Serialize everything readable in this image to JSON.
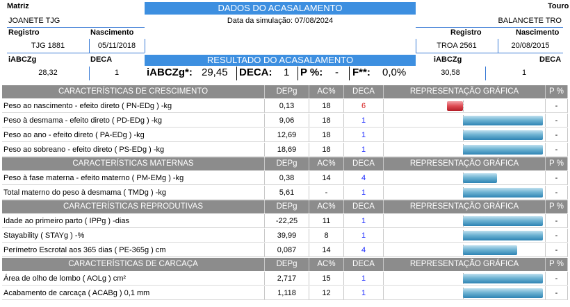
{
  "header": {
    "matriz_label": "Matriz",
    "touro_label": "Touro",
    "title": "DADOS DO ACASALAMENTO",
    "matriz_name": "JOANETE TJG",
    "touro_name": "BALANCETE TRO",
    "sim_date": "Data da simulação: 07/08/2024",
    "matriz": {
      "registro_label": "Registro",
      "nascimento_label": "Nascimento",
      "registro": "TJG 1881",
      "nascimento": "05/11/2018",
      "iabczg_label": "iABCZg",
      "deca_label": "DECA",
      "iabczg": "28,32",
      "deca": "1"
    },
    "touro": {
      "registro_label": "Registro",
      "nascimento_label": "Nascimento",
      "registro": "TROA 2561",
      "nascimento": "20/08/2015",
      "iabczg_label": "iABCZg",
      "deca_label": "DECA",
      "iabczg": "30,58",
      "deca": "1"
    },
    "resultado_title": "RESULTADO DO ACASALAMENTO",
    "resultado": {
      "iabczg_label": "iABCZg*:",
      "iabczg": "29,45",
      "deca_label": "DECA:",
      "deca": "1",
      "p_label": "P %:",
      "p": "-",
      "f_label": "F**:",
      "f": "0,0%"
    }
  },
  "columns": {
    "dep": "DEPg",
    "ac": "AC%",
    "deca": "DECA",
    "graf": "REPRESENTAÇÃO GRÁFICA",
    "p": "P %"
  },
  "colors": {
    "band_blue": "#3d8fe0",
    "section_gray": "#8c8c8c",
    "deca_blue": "#1d2cff",
    "deca_red": "#d62020"
  },
  "sections": [
    {
      "title": "CARACTERÍSTICAS DE CRESCIMENTO",
      "rows": [
        {
          "name": "Peso ao nascimento - efeito direto ( PN-EDg ) -kg",
          "dep": "0,13",
          "ac": "18",
          "deca": "6",
          "deca_color": "red",
          "bar_dir": "neg",
          "bar": 0.2,
          "p": "-"
        },
        {
          "name": "Peso à desmama - efeito direto ( PD-EDg ) -kg",
          "dep": "9,06",
          "ac": "18",
          "deca": "1",
          "deca_color": "blue",
          "bar_dir": "pos",
          "bar": 1.0,
          "p": "-"
        },
        {
          "name": "Peso ao ano - efeito direto ( PA-EDg ) -kg",
          "dep": "12,69",
          "ac": "18",
          "deca": "1",
          "deca_color": "blue",
          "bar_dir": "pos",
          "bar": 1.0,
          "p": "-"
        },
        {
          "name": "Peso ao sobreano - efeito direto ( PS-EDg ) -kg",
          "dep": "18,69",
          "ac": "18",
          "deca": "1",
          "deca_color": "blue",
          "bar_dir": "pos",
          "bar": 1.0,
          "p": "-"
        }
      ]
    },
    {
      "title": "CARACTERÍSTICAS MATERNAS",
      "rows": [
        {
          "name": "Peso à fase materna - efeito materno ( PM-EMg ) -kg",
          "dep": "0,38",
          "ac": "14",
          "deca": "4",
          "deca_color": "blue",
          "bar_dir": "pos",
          "bar": 0.43,
          "p": "-"
        },
        {
          "name": "Total materno do peso à desmama ( TMDg ) -kg",
          "dep": "5,61",
          "ac": "-",
          "deca": "1",
          "deca_color": "blue",
          "bar_dir": "pos",
          "bar": 1.0,
          "p": "-"
        }
      ]
    },
    {
      "title": "CARACTERÍSTICAS REPRODUTIVAS",
      "rows": [
        {
          "name": "Idade ao primeiro parto ( IPPg ) -dias",
          "dep": "-22,25",
          "ac": "11",
          "deca": "1",
          "deca_color": "blue",
          "bar_dir": "pos",
          "bar": 1.0,
          "p": "-"
        },
        {
          "name": "Stayability ( STAYg ) -%",
          "dep": "39,99",
          "ac": "8",
          "deca": "1",
          "deca_color": "blue",
          "bar_dir": "pos",
          "bar": 1.0,
          "p": "-"
        },
        {
          "name": "Perímetro Escrotal aos 365 dias ( PE-365g ) cm",
          "dep": "0,087",
          "ac": "14",
          "deca": "4",
          "deca_color": "blue",
          "bar_dir": "pos",
          "bar": 0.68,
          "p": "-"
        }
      ]
    },
    {
      "title": "CARACTERÍSTICAS DE CARCAÇA",
      "rows": [
        {
          "name": "Área de olho de lombo ( AOLg ) cm²",
          "dep": "2,717",
          "ac": "15",
          "deca": "1",
          "deca_color": "blue",
          "bar_dir": "pos",
          "bar": 1.0,
          "p": "-"
        },
        {
          "name": "Acabamento de carcaça ( ACABg ) 0,1 mm",
          "dep": "1,118",
          "ac": "12",
          "deca": "1",
          "deca_color": "blue",
          "bar_dir": "pos",
          "bar": 1.0,
          "p": "-"
        }
      ]
    }
  ]
}
